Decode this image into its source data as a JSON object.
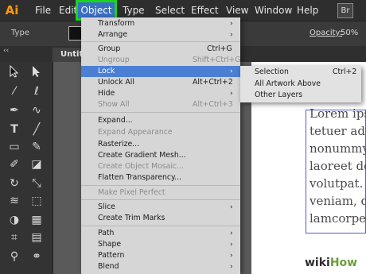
{
  "app": {
    "logo": "Ai"
  },
  "menubar": {
    "items": [
      "File",
      "Edit",
      "Object",
      "Type",
      "Select",
      "Effect",
      "View",
      "Window",
      "Help"
    ],
    "active": "Object",
    "bridge_badge": "Br"
  },
  "control_bar": {
    "selection_label": "Type",
    "opacity_label": "Opacity:",
    "opacity_value": "50%"
  },
  "document_tab": "Untit",
  "object_menu": {
    "items": [
      {
        "label": "Transform",
        "submenu": true
      },
      {
        "label": "Arrange",
        "submenu": true
      },
      {
        "label": "Group",
        "shortcut": "Ctrl+G"
      },
      {
        "label": "Ungroup",
        "shortcut": "Shift+Ctrl+G"
      },
      {
        "label": "Lock",
        "submenu": true,
        "highlighted": true
      },
      {
        "label": "Unlock All",
        "shortcut": "Alt+Ctrl+2"
      },
      {
        "label": "Hide",
        "submenu": true
      },
      {
        "label": "Show All",
        "shortcut": "Alt+Ctrl+3"
      },
      {
        "label": "Expand..."
      },
      {
        "label": "Expand Appearance"
      },
      {
        "label": "Rasterize..."
      },
      {
        "label": "Create Gradient Mesh..."
      },
      {
        "label": "Create Object Mosaic..."
      },
      {
        "label": "Flatten Transparency..."
      },
      {
        "label": "Make Pixel Perfect"
      },
      {
        "label": "Slice",
        "submenu": true
      },
      {
        "label": "Create Trim Marks"
      },
      {
        "label": "Path",
        "submenu": true
      },
      {
        "label": "Shape",
        "submenu": true
      },
      {
        "label": "Pattern",
        "submenu": true
      },
      {
        "label": "Blend",
        "submenu": true
      }
    ],
    "submenu_arrow": "›"
  },
  "lock_submenu": {
    "items": [
      {
        "label": "Selection",
        "shortcut": "Ctrl+2"
      },
      {
        "label": "All Artwork Above"
      },
      {
        "label": "Other Layers"
      }
    ]
  },
  "canvas_text": [
    "Lorem ips",
    "tetuer adip",
    "nonummy",
    "laoreet do",
    "volutpat. U",
    "veniam, qu",
    "lamcorpen"
  ],
  "watermark": {
    "wiki": "wiki",
    "how": "How"
  },
  "colors": {
    "menu_highlight": "#4a7fd4",
    "object_menu_outline": "#1cd31c",
    "logo": "#ff9a00"
  },
  "tools": [
    "selection-tool",
    "direct-selection-tool",
    "magic-wand-tool",
    "lasso-tool",
    "pen-tool",
    "curvature-tool",
    "type-tool",
    "line-tool",
    "rectangle-tool",
    "paintbrush-tool",
    "shaper-tool",
    "eraser-tool",
    "rotate-tool",
    "scale-tool",
    "width-tool",
    "free-transform-tool",
    "shape-builder-tool",
    "perspective-tool",
    "mesh-tool",
    "gradient-tool",
    "eyedropper-tool",
    "blend-tool"
  ]
}
